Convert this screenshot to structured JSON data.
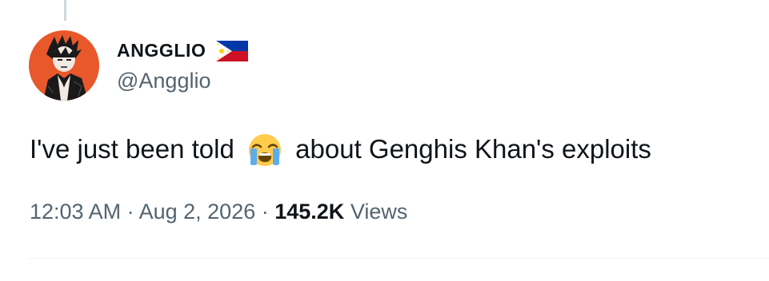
{
  "tweet": {
    "author": {
      "display_name": "ANGGLIO",
      "handle": "@Angglio",
      "flag_icon": "philippines-flag-icon",
      "avatar_icon": "avatar-image"
    },
    "text_before_emoji": "I've just been told",
    "emoji_icon": "loudly-crying-face-icon",
    "text_after_emoji": "about Genghis Khan's exploits",
    "timestamp": {
      "time": "12:03 AM",
      "separator1": " · ",
      "date": "Aug 2, 2026",
      "separator2": " · ",
      "views_count": "145.2K",
      "views_label": " Views"
    }
  },
  "colors": {
    "text_primary": "#0f1419",
    "text_secondary": "#536471",
    "avatar_bg": "#e8582b",
    "divider": "#eff3f4"
  }
}
